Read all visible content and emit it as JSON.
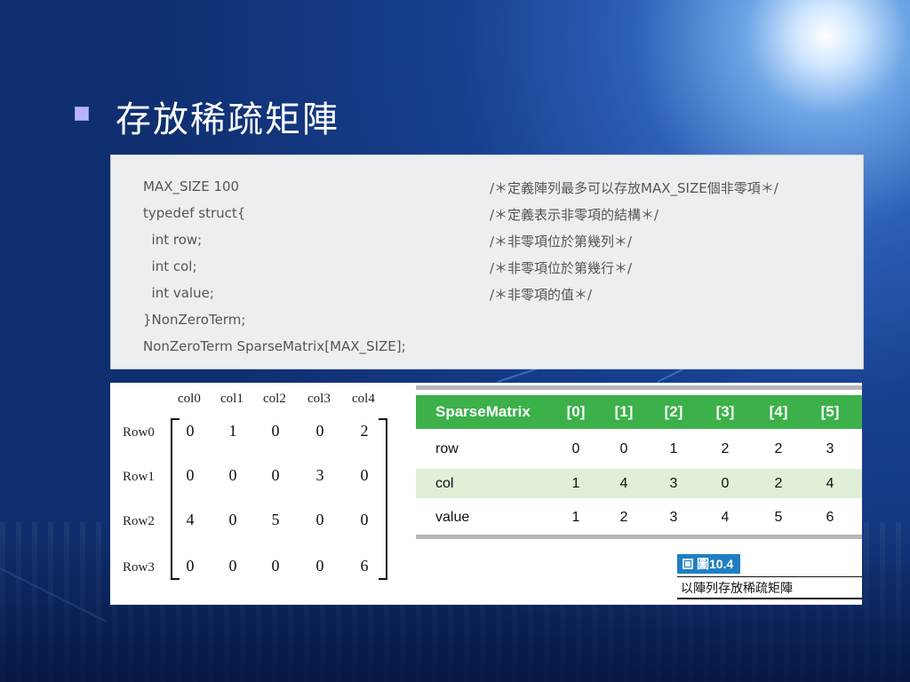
{
  "slide": {
    "title": "存放稀疏矩陣"
  },
  "code": {
    "lines": [
      {
        "code": "MAX_SIZE 100",
        "comment": "/＊定義陣列最多可以存放MAX_SIZE個非零項＊/"
      },
      {
        "code": "typedef struct{",
        "comment": "/＊定義表示非零項的結構＊/"
      },
      {
        "code": "  int row;",
        "comment": "/＊非零項位於第幾列＊/"
      },
      {
        "code": "  int col;",
        "comment": "/＊非零項位於第幾行＊/"
      },
      {
        "code": "  int value;",
        "comment": "/＊非零項的值＊/"
      },
      {
        "code": "}NonZeroTerm;",
        "comment": ""
      },
      {
        "code": "NonZeroTerm SparseMatrix[MAX_SIZE];",
        "comment": ""
      }
    ]
  },
  "matrix": {
    "col_headers": [
      "col0",
      "col1",
      "col2",
      "col3",
      "col4"
    ],
    "row_headers": [
      "Row0",
      "Row1",
      "Row2",
      "Row3"
    ],
    "values": [
      [
        "0",
        "1",
        "0",
        "0",
        "2"
      ],
      [
        "0",
        "0",
        "0",
        "3",
        "0"
      ],
      [
        "4",
        "0",
        "5",
        "0",
        "0"
      ],
      [
        "0",
        "0",
        "0",
        "0",
        "6"
      ]
    ]
  },
  "sparse_table": {
    "header": [
      "SparseMatrix",
      "[0]",
      "[1]",
      "[2]",
      "[3]",
      "[4]",
      "[5]"
    ],
    "rows": [
      {
        "label": "row",
        "values": [
          "0",
          "0",
          "1",
          "2",
          "2",
          "3"
        ]
      },
      {
        "label": "col",
        "values": [
          "1",
          "4",
          "3",
          "0",
          "2",
          "4"
        ]
      },
      {
        "label": "value",
        "values": [
          "1",
          "2",
          "3",
          "4",
          "5",
          "6"
        ]
      }
    ],
    "colors": {
      "header_bg": "#3cb14a",
      "alt_row_bg": "#dff0d6"
    }
  },
  "figure": {
    "tag": "圖10.4",
    "caption": "以陣列存放稀疏矩陣"
  }
}
